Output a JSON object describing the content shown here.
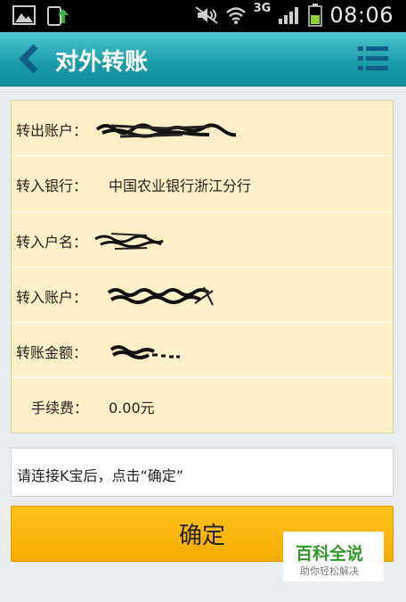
{
  "status_bar": {
    "network": "3G",
    "time": "08:06"
  },
  "header": {
    "title": "对外转账"
  },
  "transfer": {
    "rows": [
      {
        "label": "转出账户：",
        "value": ""
      },
      {
        "label": "转入银行：",
        "value": "中国农业银行浙江分行"
      },
      {
        "label": "转入户名：",
        "value": ""
      },
      {
        "label": "转入账户：",
        "value": ""
      },
      {
        "label": "转账金额：",
        "value": ""
      },
      {
        "label": "手续费：",
        "value": "0.00元"
      }
    ]
  },
  "hint": {
    "text": "请连接K宝后，点击“确定”"
  },
  "confirm_button": {
    "label": "确定"
  },
  "watermark": {
    "title": "百科全说",
    "subtitle": "助你轻松解决"
  },
  "colors": {
    "title_bar": "#1a9aa7",
    "card_background": "#fdefc6",
    "confirm_button": "#f7ab00"
  }
}
